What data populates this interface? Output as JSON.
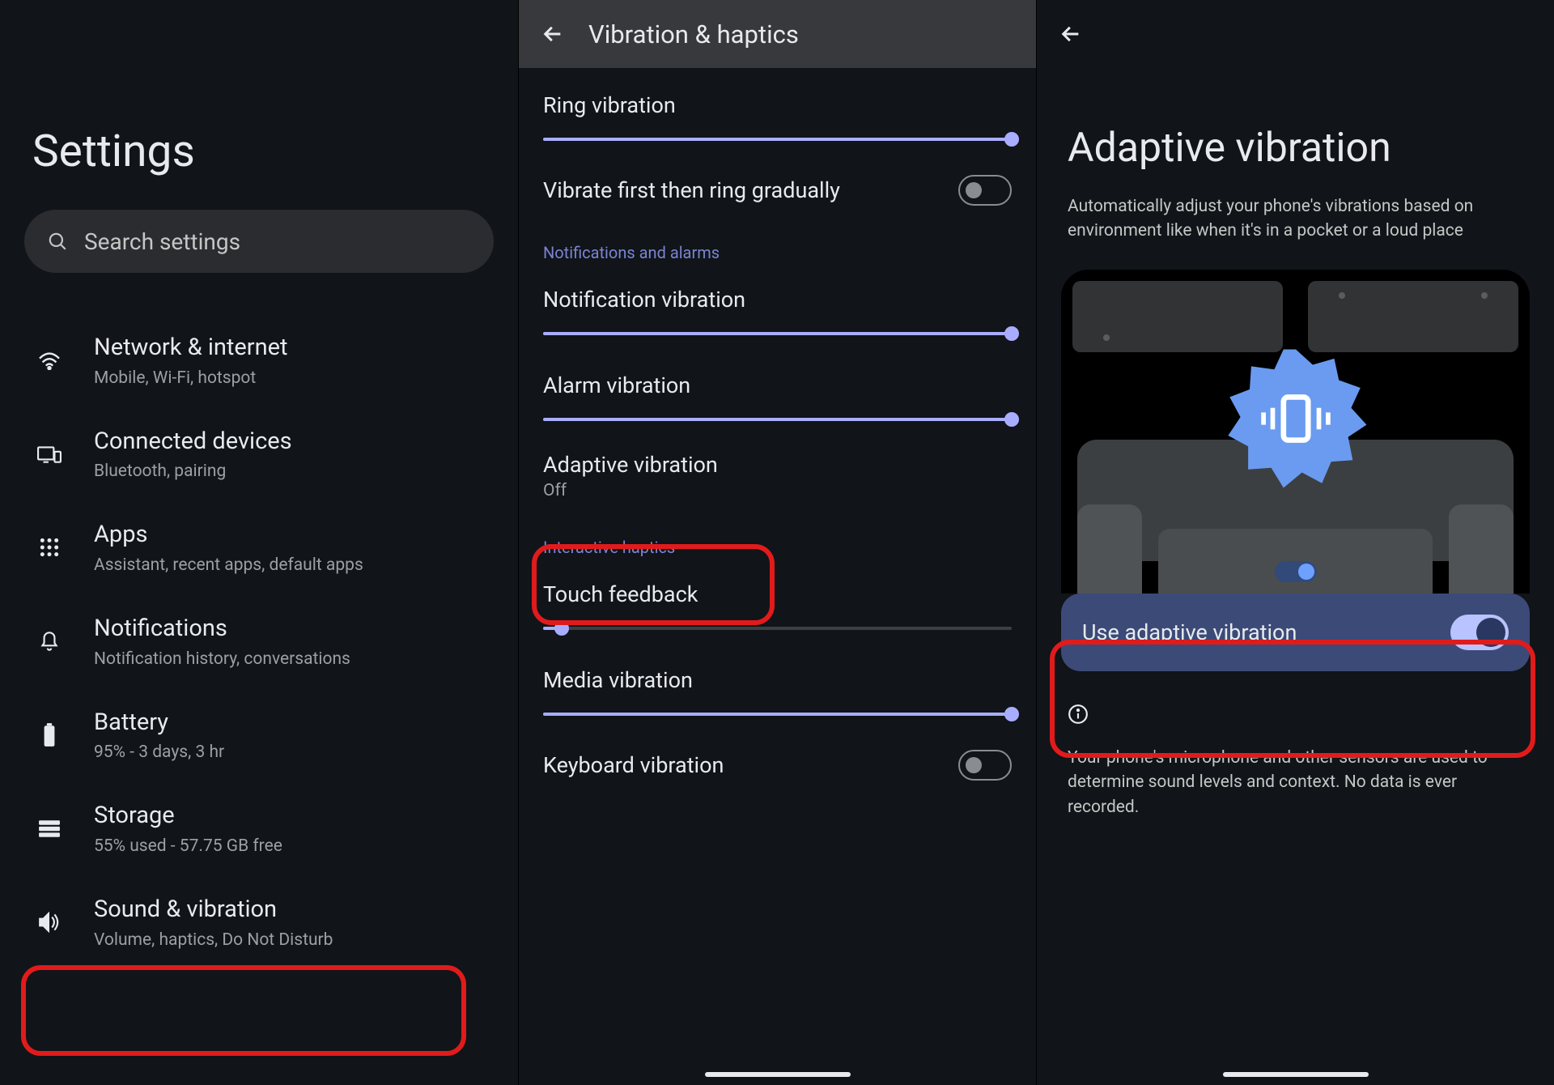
{
  "screen1": {
    "title": "Settings",
    "search_placeholder": "Search settings",
    "items": [
      {
        "title": "Network & internet",
        "subtitle": "Mobile, Wi-Fi, hotspot"
      },
      {
        "title": "Connected devices",
        "subtitle": "Bluetooth, pairing"
      },
      {
        "title": "Apps",
        "subtitle": "Assistant, recent apps, default apps"
      },
      {
        "title": "Notifications",
        "subtitle": "Notification history, conversations"
      },
      {
        "title": "Battery",
        "subtitle": "95% - 3 days, 3 hr"
      },
      {
        "title": "Storage",
        "subtitle": "55% used - 57.75 GB free"
      },
      {
        "title": "Sound & vibration",
        "subtitle": "Volume, haptics, Do Not Disturb"
      }
    ]
  },
  "screen2": {
    "header": "Vibration & haptics",
    "ring_vibration": "Ring vibration",
    "vibrate_first": "Vibrate first then ring gradually",
    "section_notif": "Notifications and alarms",
    "notification_vibration": "Notification vibration",
    "alarm_vibration": "Alarm vibration",
    "adaptive_title": "Adaptive vibration",
    "adaptive_status": "Off",
    "section_interactive": "Interactive haptics",
    "touch_feedback": "Touch feedback",
    "media_vibration": "Media vibration",
    "keyboard_vibration": "Keyboard vibration"
  },
  "screen3": {
    "title": "Adaptive vibration",
    "description": "Automatically adjust your phone's vibrations based on environment like when it's in a pocket or a loud place",
    "use_label": "Use adaptive vibration",
    "info_text": "Your phone's microphone and other sensors are used to determine sound levels and context. No data is ever recorded."
  }
}
